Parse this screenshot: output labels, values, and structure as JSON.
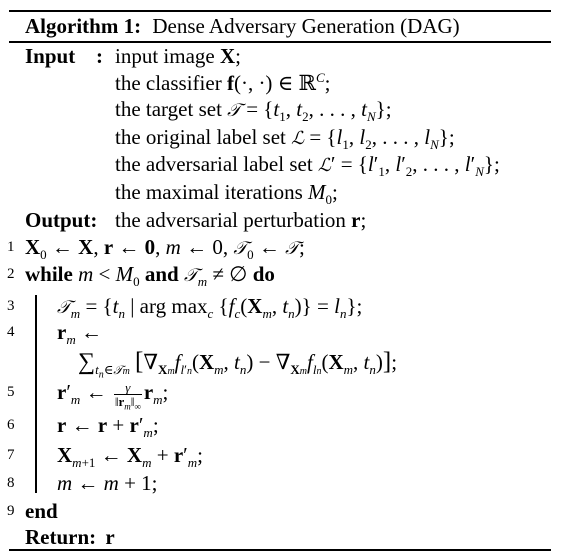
{
  "algorithm": {
    "label": "Algorithm 1:",
    "title": "Dense Adversary Generation (DAG)"
  },
  "input": {
    "keyword": "Input",
    "colon": ":",
    "lines": [
      "input image X;",
      "the classifier f(·,·) ∈ ℝ^C;",
      "the target set 𝒯 = {t₁, t₂, …, t_N};",
      "the original label set ℒ = {l₁, l₂, …, l_N};",
      "the adversarial label set ℒ′ = {l′₁, l′₂, …, l′_N};",
      "the maximal iterations M₀;"
    ],
    "parts": {
      "l1_text": "input image ",
      "l1_var": "X",
      "l2_text": "the classifier ",
      "l3_text": "the target set ",
      "l4_text": "the original label set ",
      "l5_text": "the adversarial label set ",
      "l6_text": "the maximal iterations "
    }
  },
  "output": {
    "keyword": "Output:",
    "text": "the adversarial perturbation ",
    "var": "r"
  },
  "steps": [
    {
      "num": "1",
      "text": "X₀ ← X, r ← 0, m ← 0, 𝒯₀ ← 𝒯;"
    },
    {
      "num": "2",
      "text": "while m < M₀ and 𝒯_m ≠ ∅ do"
    },
    {
      "num": "3",
      "text": "𝒯_m = {t_n | arg max_c {f_c(X_m, t_n)} = l_n};"
    },
    {
      "num": "4",
      "text": "r_m ← Σ_{t_n∈𝒯_m} [∇X_m f_{l′_n}(X_m, t_n) − ∇X_m f_{l_n}(X_m, t_n)];"
    },
    {
      "num": "5",
      "text": "r′_m ← γ/‖r_m‖∞ r_m;"
    },
    {
      "num": "6",
      "text": "r ← r + r′_m;"
    },
    {
      "num": "7",
      "text": "X_{m+1} ← X_m + r′_m;"
    },
    {
      "num": "8",
      "text": "m ← m + 1;"
    },
    {
      "num": "9",
      "text": "end"
    }
  ],
  "keywords": {
    "while": "while",
    "and": "and",
    "do": "do",
    "end": "end"
  },
  "return": {
    "keyword": "Return:",
    "var": "r"
  }
}
